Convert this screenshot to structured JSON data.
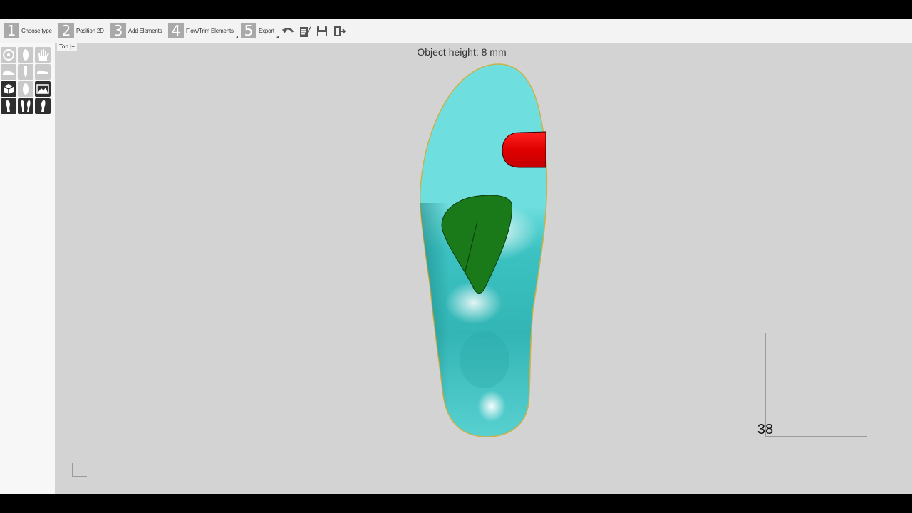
{
  "toolbar": {
    "steps": [
      {
        "number": "1",
        "label": "Choose type"
      },
      {
        "number": "2",
        "label": "Position 2D"
      },
      {
        "number": "3",
        "label": "Add Elements"
      },
      {
        "number": "4",
        "label": "Flow/Trim Elements"
      },
      {
        "number": "5",
        "label": "Export"
      }
    ],
    "tools": [
      "undo-icon",
      "edit-list-icon",
      "save-icon",
      "exit-icon"
    ]
  },
  "sidebar": {
    "buttons": [
      "view-reset-icon",
      "foot-sole-view-icon",
      "hand-icon",
      "foot-side-view-icon",
      "foot-front-view-icon",
      "foot-side-view-alt-icon",
      "box-view-icon",
      "foot-plain-icon",
      "image-icon",
      "left-foot-icon",
      "both-feet-icon",
      "right-foot-icon"
    ]
  },
  "viewport": {
    "view_label": "Top |+",
    "object_height_text": "Object height: 8 mm",
    "size_label": "38"
  },
  "colors": {
    "insole": "#5fd6d6",
    "metatarsal_pad": "#1a7a1a",
    "toe_element": "#e61414",
    "background": "#d3d3d3"
  }
}
